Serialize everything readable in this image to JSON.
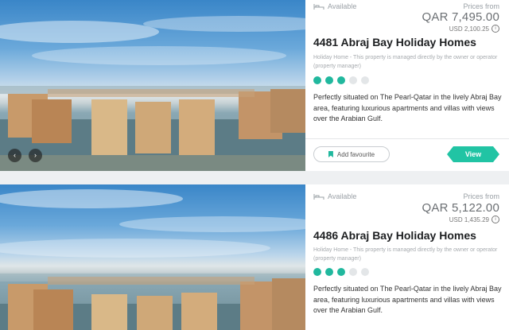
{
  "listings": [
    {
      "availability": "Available",
      "prices_from_label": "Prices from",
      "price": "QAR 7,495.00",
      "usd_price": "USD 2,100.25",
      "title": "4481 Abraj Bay Holiday Homes",
      "subtitle": "Holiday Home - This property is managed directly by the owner or operator (property manager)",
      "rating": 3,
      "rating_max": 5,
      "description": "Perfectly situated on The Pearl-Qatar in the lively Abraj Bay area, featuring luxurious apartments and villas with views over the Arabian Gulf.",
      "add_favourite": "Add favourite",
      "view_button": "View",
      "prev_arrow": "‹",
      "next_arrow": "›"
    },
    {
      "availability": "Available",
      "prices_from_label": "Prices from",
      "price": "QAR 5,122.00",
      "usd_price": "USD 1,435.29",
      "title": "4486 Abraj Bay Holiday Homes",
      "subtitle": "Holiday Home - This property is managed directly by the owner or operator (property manager)",
      "rating": 3,
      "rating_max": 5,
      "description": "Perfectly situated on The Pearl-Qatar in the lively Abraj Bay area, featuring luxurious apartments and villas with views over the Arabian Gulf."
    }
  ],
  "colors": {
    "accent": "#21c4a4",
    "star_on": "#21b89e",
    "star_off": "#e3e6e8"
  }
}
